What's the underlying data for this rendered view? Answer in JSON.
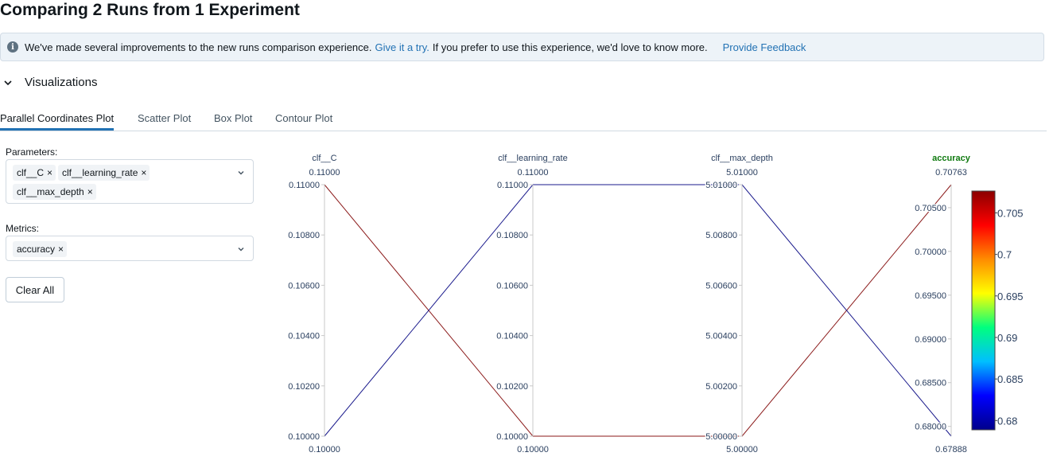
{
  "page": {
    "title": "Comparing 2 Runs from 1 Experiment"
  },
  "banner": {
    "text_before": "We've made several improvements to the new runs comparison experience.",
    "try_link": "Give it a try.",
    "text_after": "If you prefer to use this experience, we'd love to know more.",
    "feedback_link": "Provide Feedback",
    "icon": "info-icon"
  },
  "section": {
    "title": "Visualizations",
    "icon": "chevron-down-icon"
  },
  "tabs": [
    {
      "label": "Parallel Coordinates Plot",
      "active": true
    },
    {
      "label": "Scatter Plot",
      "active": false
    },
    {
      "label": "Box Plot",
      "active": false
    },
    {
      "label": "Contour Plot",
      "active": false
    }
  ],
  "controls": {
    "parameters_label": "Parameters:",
    "parameters": [
      "clf__C",
      "clf__learning_rate",
      "clf__max_depth"
    ],
    "metrics_label": "Metrics:",
    "metrics": [
      "accuracy"
    ],
    "clear_all": "Clear All",
    "remove_icon": "×"
  },
  "chart_data": {
    "type": "parallel_coordinates",
    "axes": [
      {
        "name": "clf__C",
        "min": 0.1,
        "max": 0.11,
        "max_label": "0.11000",
        "min_label": "0.10000",
        "ticks": [
          "0.10000",
          "0.10200",
          "0.10400",
          "0.10600",
          "0.10800",
          "0.11000"
        ],
        "highlight": false
      },
      {
        "name": "clf__learning_rate",
        "min": 0.1,
        "max": 0.11,
        "max_label": "0.11000",
        "min_label": "0.10000",
        "ticks": [
          "0.10000",
          "0.10200",
          "0.10400",
          "0.10600",
          "0.10800",
          "0.11000"
        ],
        "highlight": false
      },
      {
        "name": "clf__max_depth",
        "min": 5.0,
        "max": 5.01,
        "max_label": "5.01000",
        "min_label": "5.00000",
        "ticks": [
          "5.00000",
          "5.00200",
          "5.00400",
          "5.00600",
          "5.00800",
          "5.01000"
        ],
        "highlight": false
      },
      {
        "name": "accuracy",
        "min": 0.67888,
        "max": 0.70763,
        "max_label": "0.70763",
        "min_label": "0.67888",
        "ticks": [
          "0.68000",
          "0.68500",
          "0.69000",
          "0.69500",
          "0.70000",
          "0.70500"
        ],
        "highlight": true
      }
    ],
    "runs": [
      {
        "values": [
          0.11,
          0.1,
          5.0,
          0.70763
        ],
        "color": "#8b1a1a"
      },
      {
        "values": [
          0.1,
          0.11,
          5.01,
          0.67888
        ],
        "color": "#1a1a8c"
      }
    ],
    "colorbar": {
      "min": 0.67888,
      "max": 0.70763,
      "ticks": [
        "0.68",
        "0.685",
        "0.69",
        "0.695",
        "0.7",
        "0.705"
      ],
      "tick_values": [
        0.68,
        0.685,
        0.69,
        0.695,
        0.7,
        0.705
      ],
      "colorscale": [
        "#00008b",
        "#0000ff",
        "#00bfff",
        "#00ff7f",
        "#ffff00",
        "#ff8c00",
        "#ff0000",
        "#8b0000"
      ]
    },
    "accent_color": "#0f7a0f"
  }
}
